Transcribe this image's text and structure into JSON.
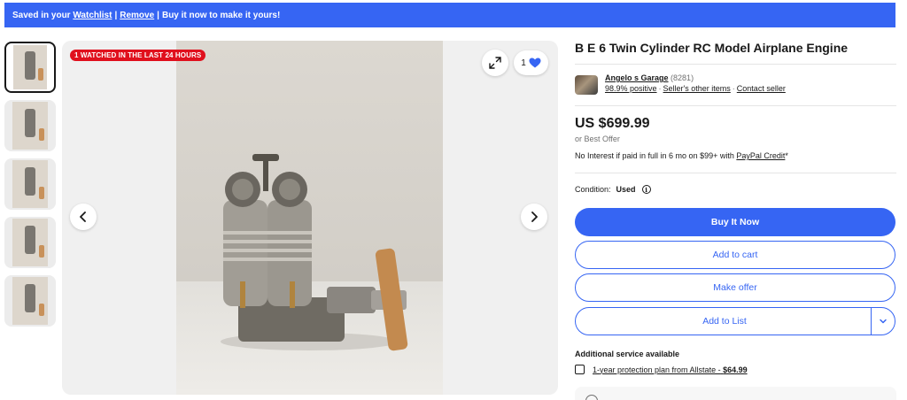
{
  "banner": {
    "saved_prefix": "Saved in your",
    "watchlist_link": "Watchlist",
    "separator_1": "|",
    "remove_link": "Remove",
    "separator_2": "|",
    "cta": "Buy it now to make it yours!"
  },
  "gallery": {
    "watched_badge": "1 WATCHED IN THE LAST 24 HOURS",
    "favorite_count": "1",
    "thumbnail_count": 5
  },
  "listing": {
    "title": "B E 6 Twin Cylinder RC Model Airplane Engine",
    "seller": {
      "name": "Angelo s Garage",
      "feedback_count": "(8281)",
      "positive": "98.9% positive",
      "other_items": "Seller's other items",
      "contact": "Contact seller"
    },
    "price": "US $699.99",
    "best_offer": "or Best Offer",
    "credit": {
      "text": "No Interest if paid in full in 6 mo on $99+ with",
      "link": "PayPal Credit",
      "suffix": "*"
    },
    "condition": {
      "label": "Condition:",
      "value": "Used"
    },
    "buttons": {
      "buy": "Buy It Now",
      "cart": "Add to cart",
      "offer": "Make offer",
      "list": "Add to List"
    },
    "additional": {
      "heading": "Additional service available",
      "plan_text": "1-year protection plan from Allstate -",
      "plan_price": "$64.99"
    }
  },
  "colors": {
    "brand_blue": "#3665f3",
    "badge_red": "#e0101d",
    "text": "#191919",
    "muted": "#707070"
  }
}
